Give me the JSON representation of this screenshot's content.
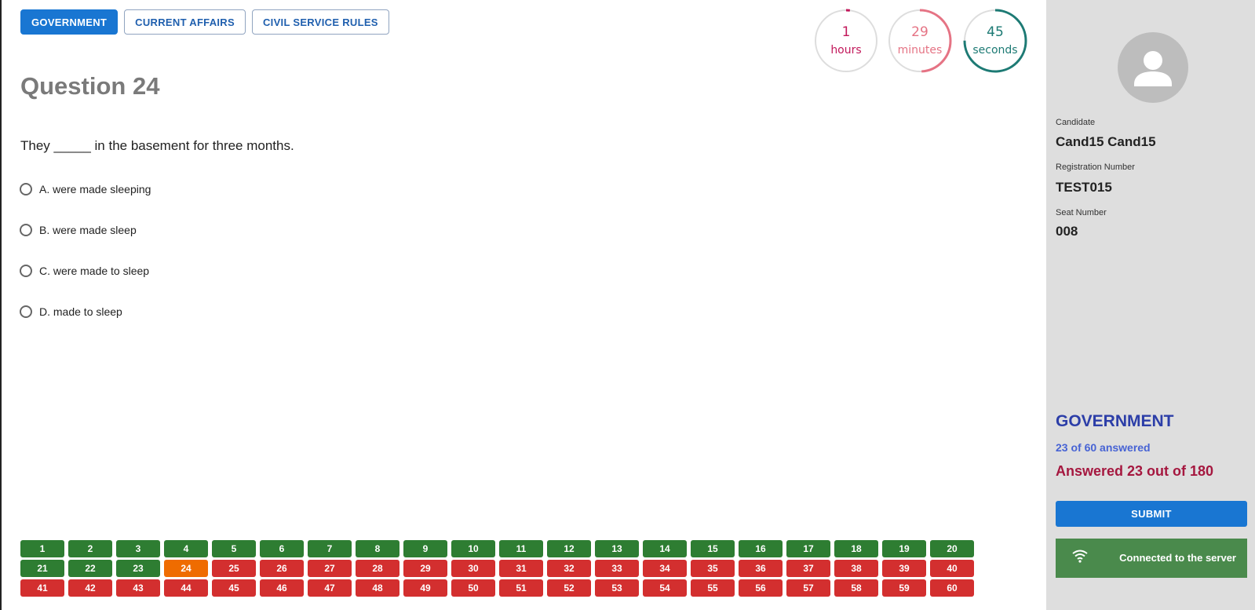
{
  "tabs": [
    "GOVERNMENT",
    "CURRENT AFFAIRS",
    "CIVIL SERVICE RULES"
  ],
  "timer": {
    "hours": {
      "value": "1",
      "unit": "hours",
      "progress": 0.02
    },
    "minutes": {
      "value": "29",
      "unit": "minutes",
      "progress": 0.49
    },
    "seconds": {
      "value": "45",
      "unit": "seconds",
      "progress": 0.75
    }
  },
  "question": {
    "title": "Question 24",
    "text": "They _____ in the basement for three months.",
    "options": [
      "A. were made sleeping",
      "B. were made sleep",
      "C. were made to sleep",
      "D. made to sleep"
    ]
  },
  "navigator": {
    "answered": [
      1,
      2,
      3,
      4,
      5,
      6,
      7,
      8,
      9,
      10,
      11,
      12,
      13,
      14,
      15,
      16,
      17,
      18,
      19,
      20,
      21,
      22,
      23
    ],
    "current": 24,
    "total": 60,
    "colors": {
      "answered": "#2e7d32",
      "current": "#ef6c00",
      "unanswered": "#d32f2f"
    }
  },
  "candidate": {
    "label": "Candidate",
    "name": "Cand15 Cand15",
    "reg_label": "Registration Number",
    "reg_number": "TEST015",
    "seat_label": "Seat Number",
    "seat_number": "008"
  },
  "section": {
    "name": "GOVERNMENT",
    "answered_text": "23 of 60 answered",
    "total_text": "Answered 23 out of 180"
  },
  "submit_label": "SUBMIT",
  "connection": {
    "text": "Connected to the server",
    "icon": "wifi-icon"
  },
  "colors": {
    "primary": "#1976d2",
    "hours": "#c2185b",
    "minutes": "#e57384",
    "seconds": "#1d7a74"
  }
}
